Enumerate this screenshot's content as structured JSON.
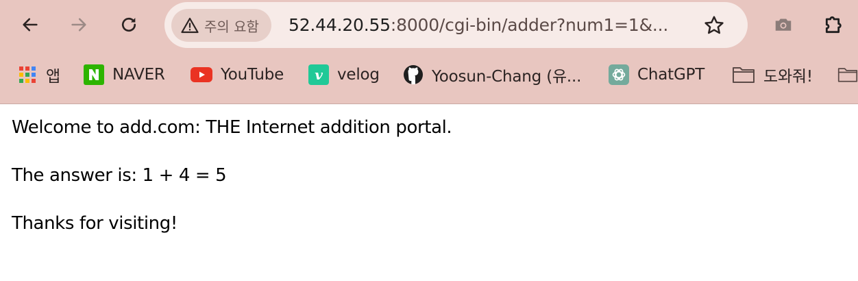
{
  "toolbar": {
    "back_icon": "arrow-left-icon",
    "forward_icon": "arrow-right-icon",
    "reload_icon": "reload-icon",
    "camera_icon": "camera-icon",
    "extensions_icon": "puzzle-icon"
  },
  "omnibox": {
    "security_label": "주의 요함",
    "security_icon": "warning-triangle-icon",
    "url_host": "52.44.20.55",
    "url_rest": ":8000/cgi-bin/adder?num1=1&...",
    "bookmark_icon": "star-icon"
  },
  "bookmarks": [
    {
      "label": "앱",
      "icon": "apps-grid-icon"
    },
    {
      "label": "NAVER",
      "icon": "naver-icon"
    },
    {
      "label": "YouTube",
      "icon": "youtube-icon"
    },
    {
      "label": "velog",
      "icon": "velog-icon"
    },
    {
      "label": "Yoosun-Chang (유...",
      "icon": "github-icon"
    },
    {
      "label": "ChatGPT",
      "icon": "chatgpt-icon"
    },
    {
      "label": "도와줘!",
      "icon": "folder-icon"
    },
    {
      "label": "",
      "icon": "folder-icon"
    }
  ],
  "page": {
    "welcome": "Welcome to add.com: THE Internet addition portal.",
    "answer": "The answer is: 1 + 4 = 5",
    "thanks": "Thanks for visiting!"
  },
  "colors": {
    "chrome_bg": "#e8c6c0",
    "omnibox_bg": "#f7ebe8",
    "youtube_red": "#ea3323",
    "naver_green": "#2db400",
    "velog_green": "#20c997"
  }
}
